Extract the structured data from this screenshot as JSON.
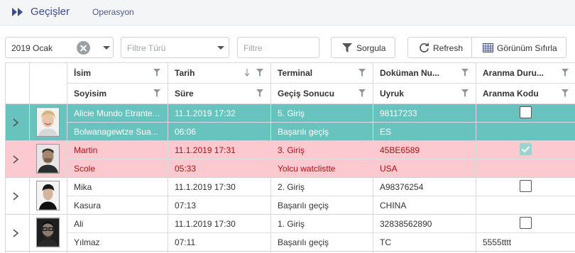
{
  "header": {
    "title": "Geçişler",
    "subtitle": "Operasyon"
  },
  "toolbar": {
    "period_value": "2019 Ocak",
    "filter_type_placeholder": "Filtre Türü",
    "filter_placeholder": "Filtre",
    "query_label": "Sorgula",
    "refresh_label": "Refresh",
    "reset_view_label": "Görünüm Sıfırla"
  },
  "grid": {
    "header_top": [
      "İsim",
      "Tarih",
      "Terminal",
      "Doküman Nu...",
      "Aranma Duru..."
    ],
    "header_bottom": [
      "Soyisim",
      "Süre",
      "Geçiş Sonucu",
      "Uyruk",
      "Aranma Kodu"
    ],
    "rows": [
      {
        "first_name": "Alicie Mundo Etrante...",
        "last_name": "Bolwanagewtze Sua...",
        "date": "11.1.2019 17:32",
        "duration": "06:06",
        "terminal": "5. Giriş",
        "result": "Başarılı geçiş",
        "doc_no": "98117233",
        "nationality": "ES",
        "wanted_code": "",
        "status_bg": "#68c3bf",
        "text_color": "#ffffff"
      },
      {
        "first_name": "Martin",
        "last_name": "Scole",
        "date": "11.1.2019 17:31",
        "duration": "05:33",
        "terminal": "3. Giriş",
        "result": "Yolcu watclistte",
        "doc_no": "45BE6589",
        "nationality": "USA",
        "wanted_code": "",
        "status_bg": "#fcc9d0",
        "text_color": "#b01010"
      },
      {
        "first_name": "Mika",
        "last_name": "Kasura",
        "date": "11.1.2019 17:30",
        "duration": "07:13",
        "terminal": "2. Giriş",
        "result": "Başarılı geçiş",
        "doc_no": "A98376254",
        "nationality": "CHINA",
        "wanted_code": "",
        "status_bg": "#ffffff",
        "text_color": "#333333"
      },
      {
        "first_name": "Ali",
        "last_name": "Yılmaz",
        "date": "11.1.2019 17:30",
        "duration": "07:11",
        "terminal": "1. Giriş",
        "result": "Başarılı geçiş",
        "doc_no": "32838562890",
        "nationality": "TC",
        "wanted_code": "5555tttt",
        "status_bg": "#ffffff",
        "text_color": "#333333"
      }
    ],
    "checked": [
      false,
      true,
      false,
      false
    ]
  },
  "colors": {
    "accent": "#3d4b8c",
    "success_row": "#68c3bf",
    "alert_row": "#fcc9d0"
  }
}
